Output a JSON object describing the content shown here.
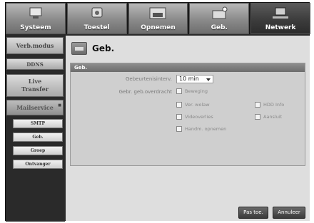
{
  "tabs": [
    {
      "label": "Systeem",
      "icon": "monitor-icon",
      "active": false
    },
    {
      "label": "Toestel",
      "icon": "camera-icon",
      "active": false
    },
    {
      "label": "Opnemen",
      "icon": "record-icon",
      "active": false
    },
    {
      "label": "Geb.",
      "icon": "event-icon",
      "active": false
    },
    {
      "label": "Netwerk",
      "icon": "network-icon",
      "active": true
    }
  ],
  "sidebar": {
    "verb_modus": "Verb.modus",
    "ddns": "DDNS",
    "live_transfer_1": "Live",
    "live_transfer_2": "Transfer",
    "mailservice": "Mailservice",
    "sub": [
      "SMTP",
      "Geb.",
      "Groep",
      "Ontvanger"
    ]
  },
  "content": {
    "title": "Geb.",
    "panel_header": "Geb.",
    "interval_label": "Gebeurtenisinterv.",
    "interval_value": "10 min",
    "event_label": "Gebr. geb.overdracht",
    "checks": {
      "motion": "Beweging",
      "alarm": "Ver. wolaw",
      "hdd": "HDD Info",
      "video_loss": "Videoverlies",
      "connect": "Aansluit",
      "manual_rec": "Handm. opnemen"
    }
  },
  "buttons": {
    "apply": "Pas toe.",
    "cancel": "Annuleer"
  }
}
